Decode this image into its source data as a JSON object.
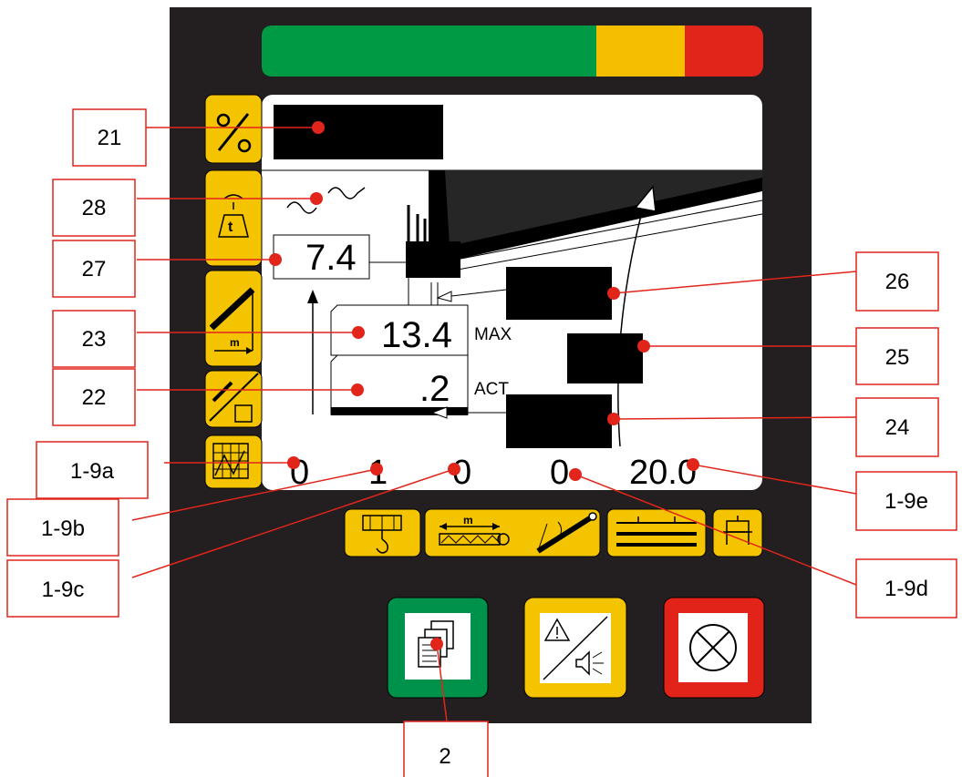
{
  "colors": {
    "panel": "#231f20",
    "load_green": "#009a44",
    "load_yellow": "#f5bf00",
    "load_red": "#e1251b",
    "key_yellow": "#f5c400",
    "key_green": "#00914a",
    "key_red": "#e2231a",
    "screen": "#ffffff",
    "callout_line": "#e1251b",
    "callout_dot": "#e1251b"
  },
  "screen": {
    "boom_angle_value": "7.4",
    "max_load_value": "13.4",
    "max_label": "MAX",
    "actual_load_value": ".2",
    "act_label": "ACT",
    "footer_values": [
      "0",
      "1",
      "0",
      "0",
      "20.0"
    ]
  },
  "callouts": {
    "c21": "21",
    "c28": "28",
    "c27": "27",
    "c23": "23",
    "c22": "22",
    "c1_9a": "1-9a",
    "c1_9b": "1-9b",
    "c1_9c": "1-9c",
    "c26": "26",
    "c25": "25",
    "c24": "24",
    "c1_9e": "1-9e",
    "c1_9d": "1-9d",
    "c2": "2"
  },
  "icons": {
    "side_keys": [
      "percent-icon",
      "load-weight-icon",
      "boom-radius-icon",
      "rigging-chart-icon",
      "grid-table-icon"
    ],
    "bottom_keys": [
      "hook-block-icon",
      "outrigger-span-icon",
      "boom-angle-icon",
      "layers-icon",
      "counterweight-icon"
    ],
    "action_keys": [
      "pages-icon",
      "warning-mute-icon",
      "cancel-circle-icon"
    ]
  }
}
